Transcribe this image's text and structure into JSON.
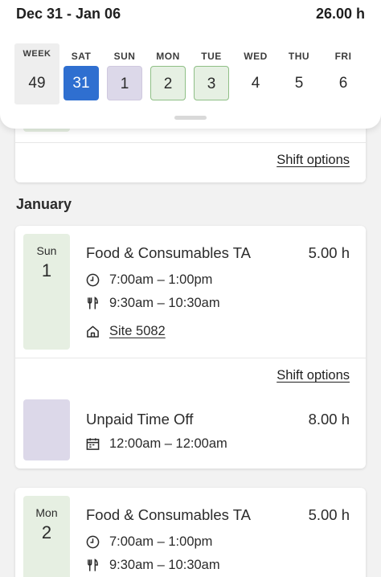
{
  "header": {
    "range": "Dec 31 - Jan 06",
    "total_hours": "26.00 h"
  },
  "week": {
    "label": "WEEK",
    "number": "49",
    "days": [
      {
        "name": "SAT",
        "num": "31",
        "state": "selected"
      },
      {
        "name": "SUN",
        "num": "1",
        "state": "time-off"
      },
      {
        "name": "MON",
        "num": "2",
        "state": "scheduled"
      },
      {
        "name": "TUE",
        "num": "3",
        "state": "scheduled"
      },
      {
        "name": "WED",
        "num": "4",
        "state": "none"
      },
      {
        "name": "THU",
        "num": "5",
        "state": "none"
      },
      {
        "name": "FRI",
        "num": "6",
        "state": "none"
      }
    ]
  },
  "colors": {
    "selected": "#2f6fd0",
    "scheduled": "#e6efe2",
    "time_off": "#dcd8e9"
  },
  "top_card": {
    "shift_options": "Shift options"
  },
  "month_label": "January",
  "cards": [
    {
      "dow": "Sun",
      "dom": "1",
      "shift": {
        "title": "Food & Consumables TA",
        "hours": "5.00 h",
        "time": "7:00am – 1:00pm",
        "meal": "9:30am – 10:30am",
        "site": "Site 5082"
      },
      "shift_options": "Shift options",
      "time_off": {
        "title": "Unpaid Time Off",
        "hours": "8.00 h",
        "time": "12:00am – 12:00am"
      }
    },
    {
      "dow": "Mon",
      "dom": "2",
      "shift": {
        "title": "Food & Consumables TA",
        "hours": "5.00 h",
        "time": "7:00am – 1:00pm",
        "meal": "9:30am – 10:30am"
      }
    }
  ],
  "icons": {
    "clock": "clock-icon",
    "meal": "fork-knife-icon",
    "site": "home-icon",
    "calendar": "calendar-icon"
  }
}
